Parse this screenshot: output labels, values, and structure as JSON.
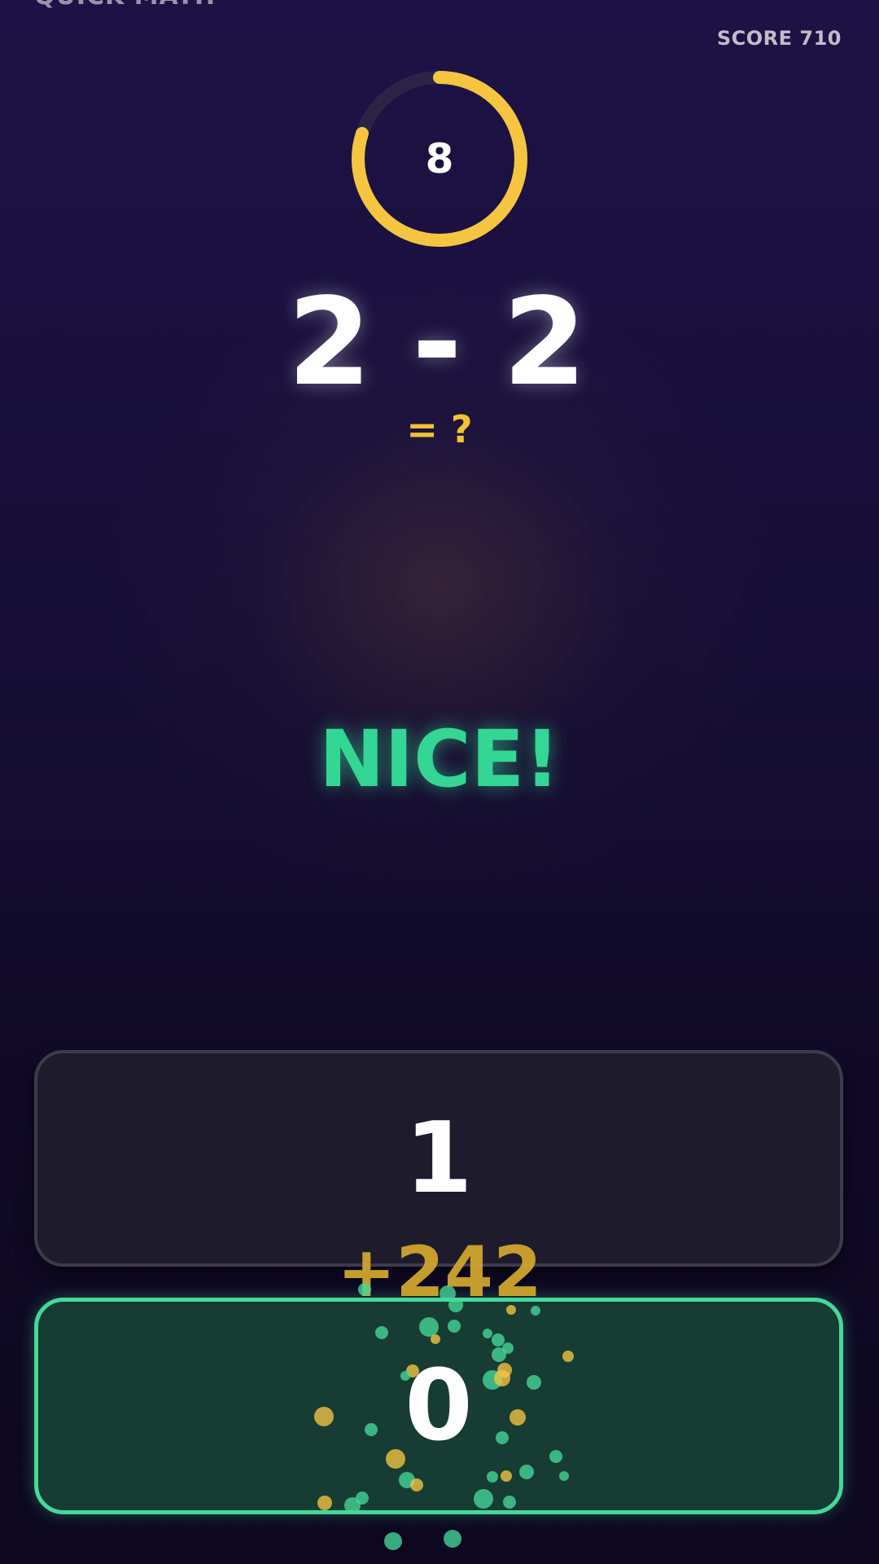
{
  "app": {
    "title": "QUICK MATH"
  },
  "score": {
    "label": "SCORE",
    "value": "710"
  },
  "timer": {
    "value": "8",
    "fraction_remaining": 0.8
  },
  "question": {
    "left": "2",
    "operator": "-",
    "right": "2",
    "prompt": "= ?"
  },
  "feedback": {
    "text": "NICE!"
  },
  "answers": [
    {
      "label": "1",
      "state": "default"
    },
    {
      "label": "0",
      "state": "correct"
    }
  ],
  "points_popup": {
    "text": "+242"
  },
  "colors": {
    "accent_yellow": "#f5c542",
    "correct_green": "#45d99a",
    "background_top": "#1d1245",
    "background_bottom": "#0d0820"
  }
}
